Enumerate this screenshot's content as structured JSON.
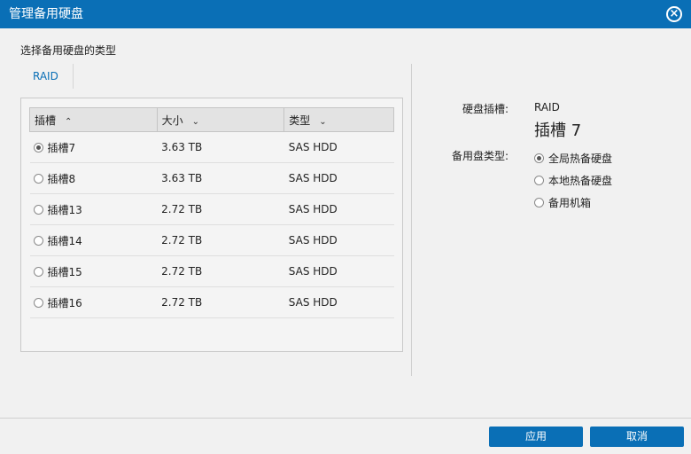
{
  "title": "管理备用硬盘",
  "prompt": "选择备用硬盘的类型",
  "tab": "RAID",
  "table": {
    "headers": [
      "插槽",
      "大小",
      "类型"
    ],
    "rows": [
      {
        "slot": "插槽7",
        "size": "3.63 TB",
        "type": "SAS HDD",
        "selected": true
      },
      {
        "slot": "插槽8",
        "size": "3.63 TB",
        "type": "SAS HDD",
        "selected": false
      },
      {
        "slot": "插槽13",
        "size": "2.72 TB",
        "type": "SAS HDD",
        "selected": false
      },
      {
        "slot": "插槽14",
        "size": "2.72 TB",
        "type": "SAS HDD",
        "selected": false
      },
      {
        "slot": "插槽15",
        "size": "2.72 TB",
        "type": "SAS HDD",
        "selected": false
      },
      {
        "slot": "插槽16",
        "size": "2.72 TB",
        "type": "SAS HDD",
        "selected": false
      }
    ]
  },
  "detail": {
    "slot_label": "硬盘插槽:",
    "slot_type": "RAID",
    "slot_name": "插槽 7",
    "spare_type_label": "备用盘类型:",
    "options": [
      {
        "label": "全局热备硬盘",
        "selected": true
      },
      {
        "label": "本地热备硬盘",
        "selected": false
      },
      {
        "label": "备用机箱",
        "selected": false
      }
    ]
  },
  "buttons": {
    "apply": "应用",
    "cancel": "取消"
  },
  "colors": {
    "accent": "#0a6fb6"
  }
}
